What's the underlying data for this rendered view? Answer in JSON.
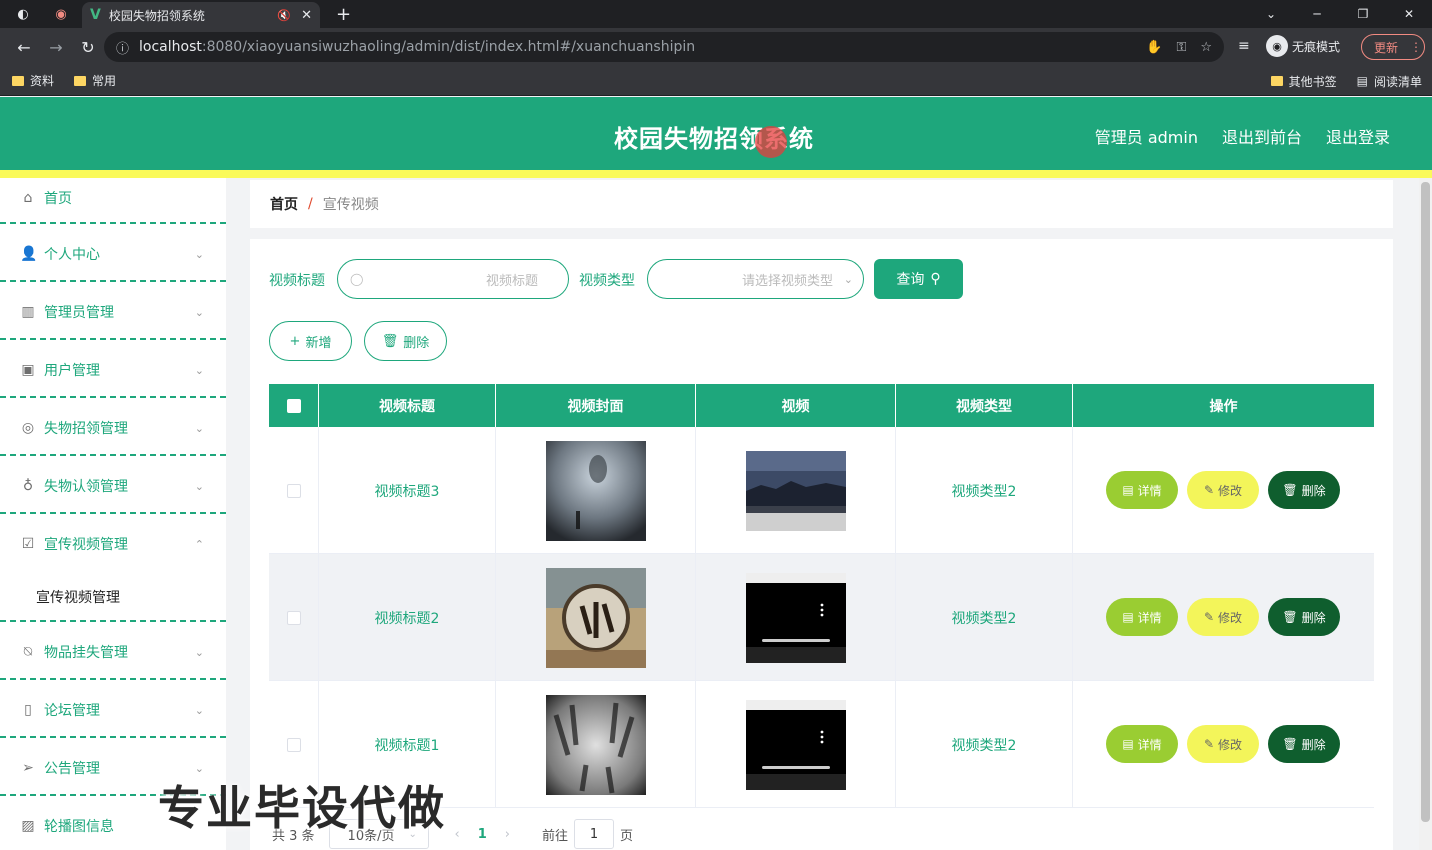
{
  "browser": {
    "tab_title": "校园失物招领系统",
    "url_host": "localhost",
    "url_path": ":8080/xiaoyuansiwuzhaoling/admin/dist/index.html#/xuanchuanshipin",
    "incognito_label": "无痕模式",
    "update_label": "更新",
    "bookmarks": [
      "资料",
      "常用"
    ],
    "bookmarks_right": [
      "其他书签",
      "阅读清单"
    ]
  },
  "header": {
    "title": "校园失物招领系统",
    "admin_label": "管理员 admin",
    "to_front_label": "退出到前台",
    "logout_label": "退出登录",
    "accent_color": "#1ea77c"
  },
  "sidebar": {
    "items": [
      {
        "label": "首页",
        "icon": "home-icon"
      },
      {
        "label": "个人中心",
        "icon": "user-icon"
      },
      {
        "label": "管理员管理",
        "icon": "books-icon"
      },
      {
        "label": "用户管理",
        "icon": "clipboard-icon"
      },
      {
        "label": "失物招领管理",
        "icon": "lifebuoy-icon"
      },
      {
        "label": "失物认领管理",
        "icon": "microphone-icon"
      },
      {
        "label": "宣传视频管理",
        "icon": "check-square-icon"
      },
      {
        "label": "物品挂失管理",
        "icon": "bell-off-icon"
      },
      {
        "label": "论坛管理",
        "icon": "phone-icon"
      },
      {
        "label": "公告管理",
        "icon": "send-icon"
      },
      {
        "label": "轮播图信息",
        "icon": "chart-icon"
      }
    ],
    "sub_item": "宣传视频管理"
  },
  "breadcrumb": {
    "home": "首页",
    "separator": "/",
    "current": "宣传视频"
  },
  "search": {
    "title_label": "视频标题",
    "title_placeholder": "视频标题",
    "type_label": "视频类型",
    "type_placeholder": "请选择视频类型",
    "query_label": "查询"
  },
  "actions": {
    "add_label": "新增",
    "delete_label": "删除"
  },
  "table": {
    "headers": [
      "视频标题",
      "视频封面",
      "视频",
      "视频类型",
      "操作"
    ],
    "rows": [
      {
        "title": "视频标题3",
        "type": "视频类型2"
      },
      {
        "title": "视频标题2",
        "type": "视频类型2"
      },
      {
        "title": "视频标题1",
        "type": "视频类型2"
      }
    ],
    "op_detail": "详情",
    "op_edit": "修改",
    "op_delete": "删除"
  },
  "pagination": {
    "total": "共 3 条",
    "page_size": "10条/页",
    "current_page": "1",
    "goto_label": "前往",
    "goto_value": "1",
    "page_suffix": "页"
  },
  "watermark": "专业毕设代做"
}
